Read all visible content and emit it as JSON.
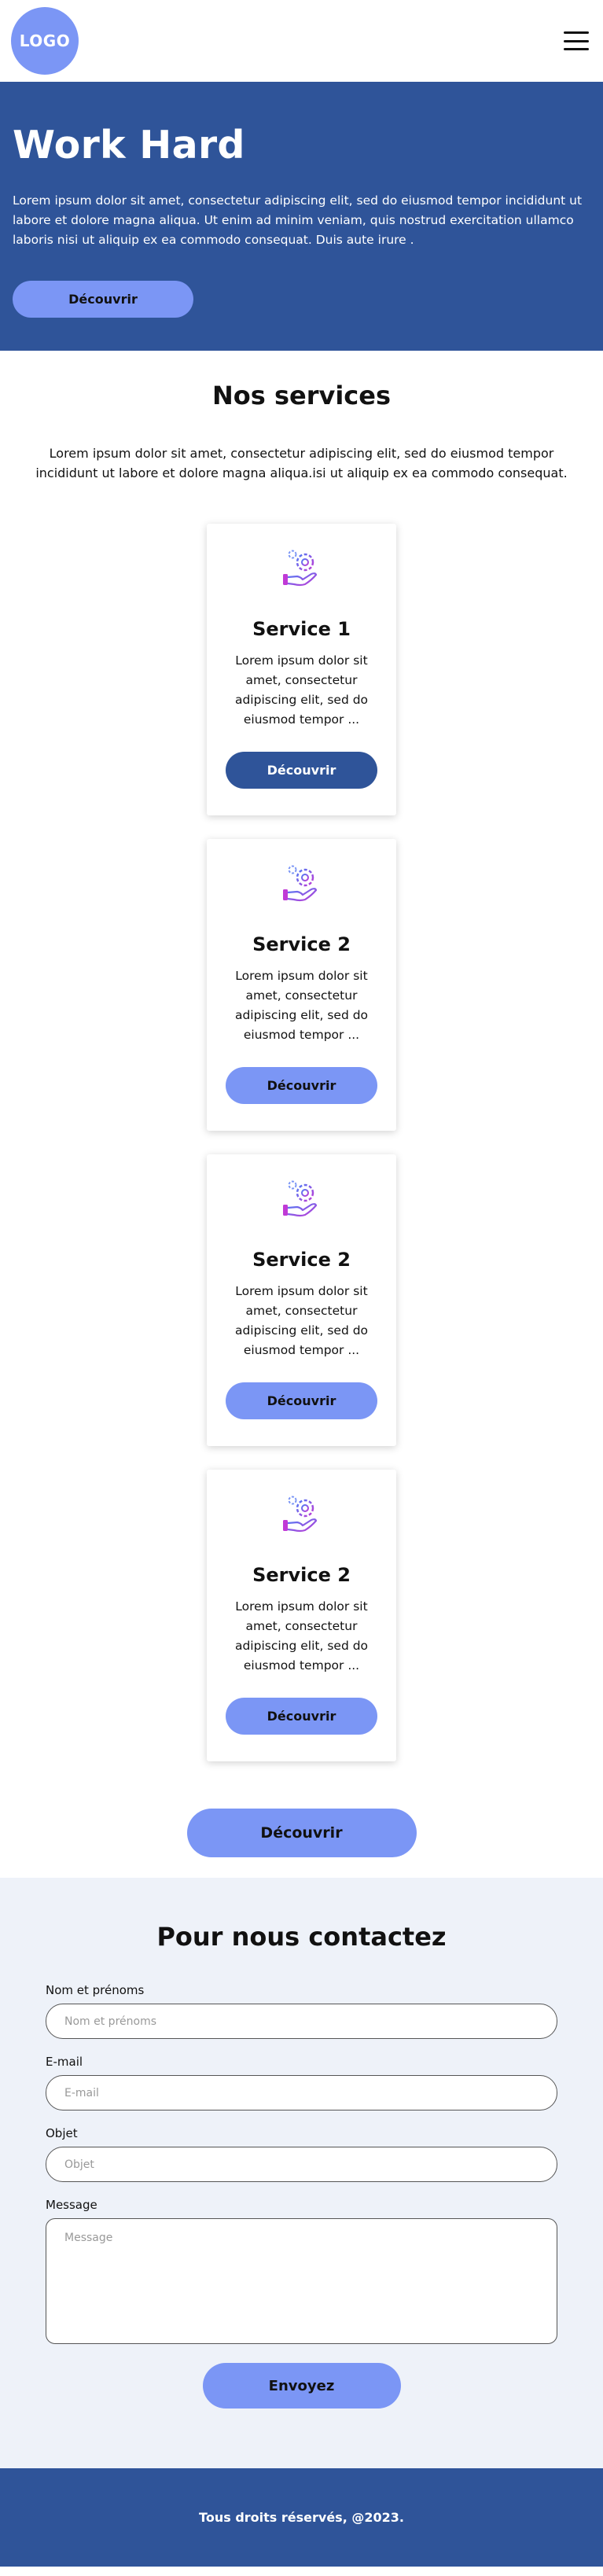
{
  "header": {
    "logo": "LOGO",
    "menu_icon": "hamburger-menu-icon"
  },
  "hero": {
    "title": "Work Hard",
    "text": "Lorem ipsum dolor sit amet, consectetur adipiscing elit, sed do eiusmod tempor incididunt ut labore et dolore magna aliqua. Ut enim ad minim veniam, quis nostrud exercitation ullamco laboris nisi ut aliquip ex ea commodo consequat. Duis aute irure .",
    "button": "Découvrir"
  },
  "services": {
    "title": "Nos services",
    "intro": "Lorem ipsum dolor sit amet, consectetur adipiscing elit, sed do eiusmod tempor incididunt ut labore et dolore magna aliqua.isi ut aliquip ex ea commodo consequat.",
    "cards": [
      {
        "title": "Service 1",
        "text": "Lorem ipsum dolor sit amet, consectetur adipiscing elit, sed do eiusmod tempor ...",
        "button": "Découvrir",
        "icon": "hand-gear-icon",
        "hovered": true
      },
      {
        "title": "Service 2",
        "text": "Lorem ipsum dolor sit amet, consectetur adipiscing elit, sed do eiusmod tempor ...",
        "button": "Découvrir",
        "icon": "hand-gear-icon",
        "hovered": false
      },
      {
        "title": "Service 2",
        "text": "Lorem ipsum dolor sit amet, consectetur adipiscing elit, sed do eiusmod tempor ...",
        "button": "Découvrir",
        "icon": "hand-gear-icon",
        "hovered": false
      },
      {
        "title": "Service 2",
        "text": "Lorem ipsum dolor sit amet, consectetur adipiscing elit, sed do eiusmod tempor ...",
        "button": "Découvrir",
        "icon": "hand-gear-icon",
        "hovered": false
      }
    ],
    "more_button": "Découvrir"
  },
  "contact": {
    "title": "Pour nous contactez",
    "fields": {
      "name": {
        "label": "Nom et prénoms",
        "placeholder": "Nom et prénoms",
        "value": ""
      },
      "email": {
        "label": "E-mail",
        "placeholder": "E-mail",
        "value": ""
      },
      "subject": {
        "label": "Objet",
        "placeholder": "Objet",
        "value": ""
      },
      "message": {
        "label": "Message",
        "placeholder": "Message",
        "value": ""
      }
    },
    "submit": "Envoyez"
  },
  "footer": {
    "text": "Tous droits réservés, @2023."
  },
  "colors": {
    "primary": "#2f5499",
    "accent": "#7b96f5",
    "contact_bg": "#eef2f9"
  }
}
